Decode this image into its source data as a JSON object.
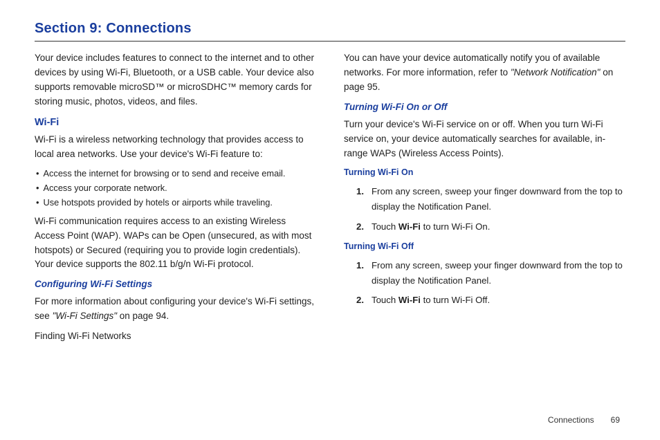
{
  "title": "Section 9: Connections",
  "footer": {
    "label": "Connections",
    "page": "69"
  },
  "left": {
    "intro": "Your device includes features to connect to the internet and to other devices by using Wi-Fi, Bluetooth, or a USB cable. Your device also supports removable microSD™ or microSDHC™ memory cards for storing music, photos, videos, and files.",
    "wifi_heading": "Wi-Fi",
    "wifi_intro": "Wi-Fi is a wireless networking technology that provides access to local area networks. Use your device's Wi-Fi feature to:",
    "bullets": [
      "Access the internet for browsing or to send and receive email.",
      "Access your corporate network.",
      "Use hotspots provided by hotels or airports while traveling."
    ],
    "wifi_req": "Wi-Fi communication requires access to an existing Wireless Access Point (WAP). WAPs can be Open (unsecured, as with most hotspots) or Secured (requiring you to provide login credentials). Your device supports the 802.11 b/g/n Wi-Fi protocol.",
    "cfg_heading": "Configuring Wi-Fi Settings",
    "cfg_pre": "For more information about configuring your device's Wi-Fi settings, see ",
    "cfg_ref": "\"Wi-Fi Settings\"",
    "cfg_post": " on page 94.",
    "finding": "Finding Wi-Fi Networks"
  },
  "right": {
    "notify_pre": "You can have your device automatically notify you of available networks. For more information, refer to ",
    "notify_ref": "\"Network Notification\"",
    "notify_post": " on page 95.",
    "onoff_heading": "Turning Wi-Fi On or Off",
    "onoff_text": "Turn your device's Wi-Fi service on or off. When you turn Wi-Fi service on, your device automatically searches for available, in-range WAPs (Wireless Access Points).",
    "on_heading": "Turning Wi-Fi On",
    "on_steps": [
      {
        "n": "1.",
        "text": "From any screen, sweep your finger downward from the top to display the Notification Panel."
      },
      {
        "n": "2.",
        "pre": "Touch ",
        "bold": "Wi-Fi",
        "post": " to turn Wi-Fi On."
      }
    ],
    "off_heading": "Turning Wi-Fi Off",
    "off_steps": [
      {
        "n": "1.",
        "text": "From any screen, sweep your finger downward from the top to display the Notification Panel."
      },
      {
        "n": "2.",
        "pre": "Touch ",
        "bold": "Wi-Fi",
        "post": " to turn Wi-Fi Off."
      }
    ]
  }
}
